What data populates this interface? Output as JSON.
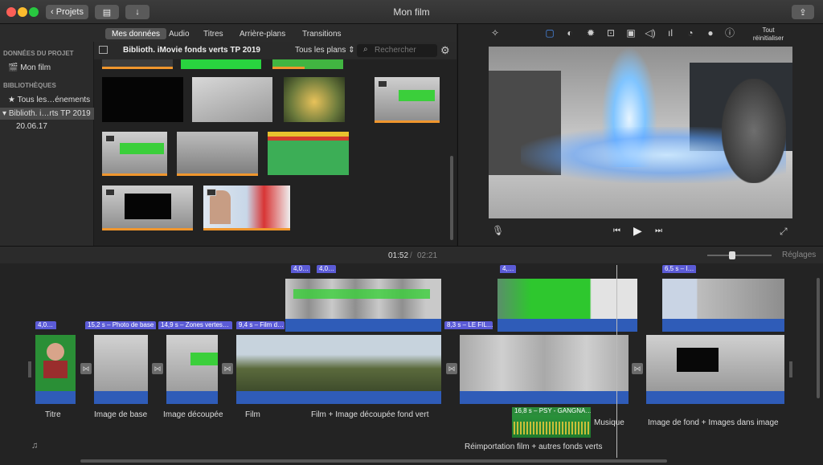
{
  "window": {
    "title": "Mon film",
    "back_label": "Projets"
  },
  "browser_tabs": [
    "Mes données",
    "Audio",
    "Titres",
    "Arrière-plans",
    "Transitions"
  ],
  "sidebar": {
    "project_header": "DONNÉES DU PROJET",
    "project_item": "Mon film",
    "libraries_header": "BIBLIOTHÈQUES",
    "library_items": [
      "Tous les…énements",
      "Biblioth. i…rts TP 2019",
      "20.06.17"
    ]
  },
  "library_bar": {
    "title": "Biblioth. iMovie fonds verts TP 2019",
    "filter": "Tous les plans",
    "search_placeholder": "Rechercher"
  },
  "viewer": {
    "reset_label": "Tout réinitialiser"
  },
  "timeline": {
    "current_time": "01:52",
    "separator": "/",
    "total_time": "02:21",
    "settings_label": "Réglages",
    "clip_labels": [
      "4,0…",
      "15,2 s – Photo de base",
      "14,9 s – Zones vertes…",
      "9,4 s – Film d…",
      "8,3 s – LE FIL…",
      "6,5 s – I…",
      "4,0…",
      "4,0…",
      "4,…"
    ],
    "audio_label": "16,8 s – PSY - GANGNA…",
    "captions": [
      "Titre",
      "Image de base",
      "Image découpée",
      "Film",
      "Film + Image découpée fond vert",
      "Musique",
      "Image de fond + Images dans image",
      "Réimportation film + autres fonds verts"
    ]
  }
}
